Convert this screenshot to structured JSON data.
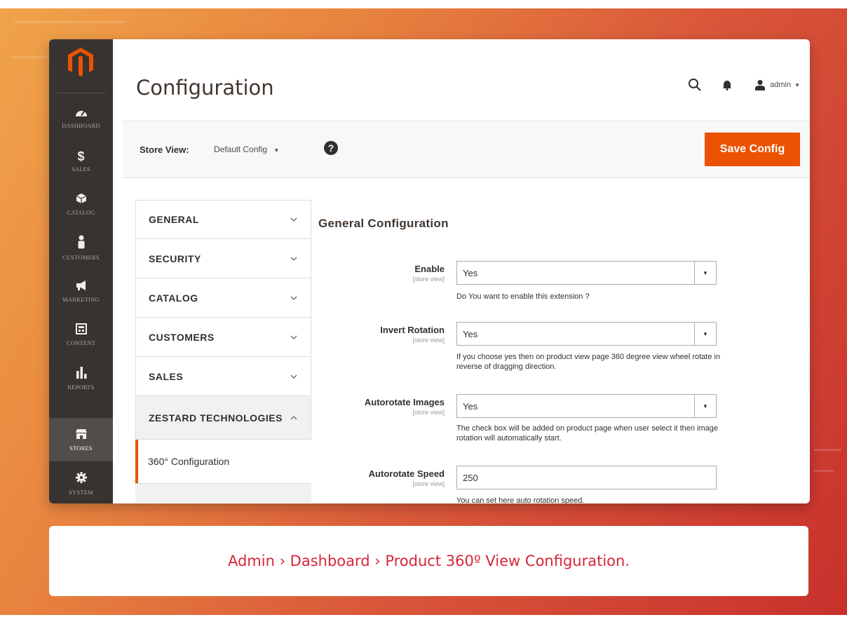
{
  "app": {
    "title": "Configuration"
  },
  "sidebar": {
    "items": [
      {
        "label": "DASHBOARD",
        "icon": "dashboard-icon"
      },
      {
        "label": "SALES",
        "icon": "dollar-icon"
      },
      {
        "label": "CATALOG",
        "icon": "cube-icon"
      },
      {
        "label": "CUSTOMERS",
        "icon": "person-icon"
      },
      {
        "label": "MARKETING",
        "icon": "megaphone-icon"
      },
      {
        "label": "CONTENT",
        "icon": "layout-icon"
      },
      {
        "label": "REPORTS",
        "icon": "bar-chart-icon"
      },
      {
        "label": "STORES",
        "icon": "store-icon"
      },
      {
        "label": "SYSTEM",
        "icon": "gear-icon"
      }
    ],
    "active": "STORES"
  },
  "header": {
    "user": "admin"
  },
  "toolbar": {
    "store_view_label": "Store View:",
    "store_view_value": "Default Config",
    "help": "?",
    "save_label": "Save Config"
  },
  "tabs": [
    {
      "label": "GENERAL"
    },
    {
      "label": "SECURITY"
    },
    {
      "label": "CATALOG"
    },
    {
      "label": "CUSTOMERS"
    },
    {
      "label": "SALES"
    },
    {
      "label": "ZESTARD TECHNOLOGIES"
    }
  ],
  "subtab": {
    "label": "360° Configuration"
  },
  "section": {
    "title": "General Configuration"
  },
  "fields": [
    {
      "label": "Enable",
      "scope": "[store view]",
      "value": "Yes",
      "note": "Do You want to enable this extension ?"
    },
    {
      "label": "Invert Rotation",
      "scope": "[store view]",
      "value": "Yes",
      "note": "If you choose yes then on product view page 360 degree view wheel rotate in reverse of dragging direction."
    },
    {
      "label": "Autorotate Images",
      "scope": "[store view]",
      "value": "Yes",
      "note": "The check box will be added on product page when user select it then image rotation will automatically start."
    },
    {
      "label": "Autorotate Speed",
      "scope": "[store view]",
      "value": "250",
      "note": "You can set here auto rotation speed."
    }
  ],
  "caption": "Admin › Dashboard › Product 360º View Configuration.",
  "colors": {
    "accent": "#eb5202",
    "sidebar": "#373330",
    "caption": "#d8263a"
  }
}
